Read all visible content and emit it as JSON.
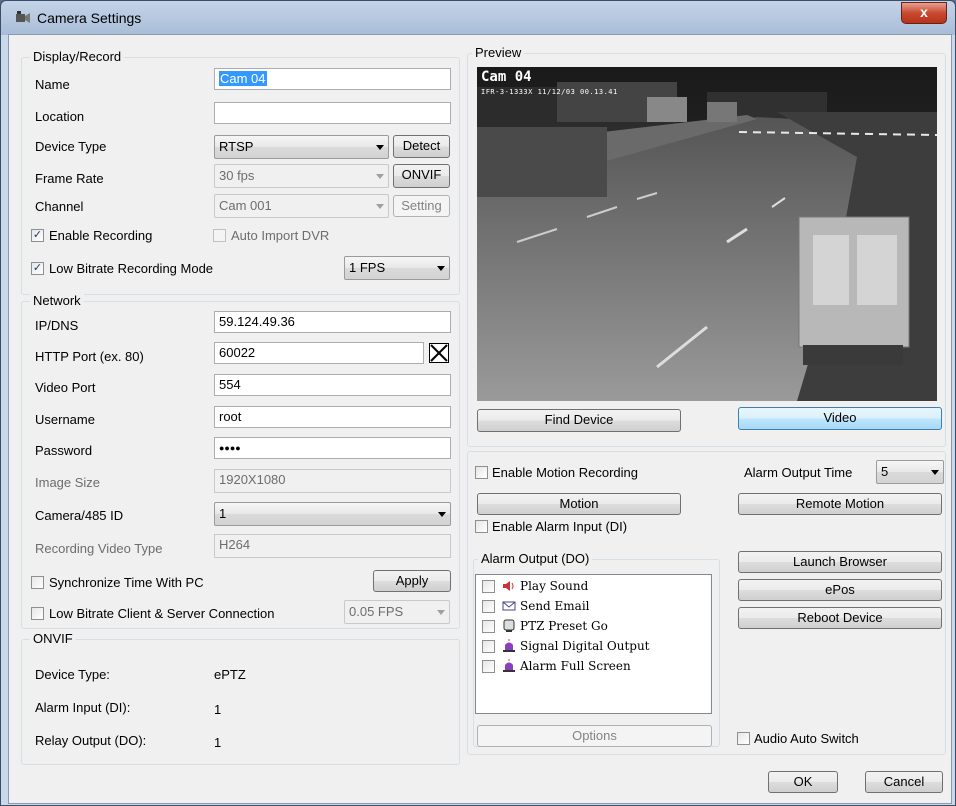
{
  "window": {
    "title": "Camera Settings",
    "close": "x"
  },
  "display_record": {
    "legend": "Display/Record",
    "name_label": "Name",
    "name_value": "Cam 04",
    "location_label": "Location",
    "location_value": "",
    "device_type_label": "Device Type",
    "device_type_value": "RTSP",
    "detect_button": "Detect",
    "frame_rate_label": "Frame Rate",
    "frame_rate_value": "30 fps",
    "onvif_button": "ONVIF",
    "channel_label": "Channel",
    "channel_value": "Cam 001",
    "setting_button": "Setting",
    "enable_recording_label": "Enable Recording",
    "enable_recording_checked": true,
    "auto_import_label": "Auto Import DVR",
    "auto_import_checked": false,
    "low_bitrate_label": "Low Bitrate Recording Mode",
    "low_bitrate_checked": true,
    "low_bitrate_value": "1 FPS"
  },
  "network": {
    "legend": "Network",
    "ip_label": "IP/DNS",
    "ip_value": "59.124.49.36",
    "http_port_label": "HTTP Port (ex. 80)",
    "http_port_value": "60022",
    "video_port_label": "Video Port",
    "video_port_value": "554",
    "username_label": "Username",
    "username_value": "root",
    "password_label": "Password",
    "password_value": "●●●●",
    "image_size_label": "Image Size",
    "image_size_value": "1920X1080",
    "camera_id_label": "Camera/485 ID",
    "camera_id_value": "1",
    "recording_type_label": "Recording Video Type",
    "recording_type_value": "H264",
    "sync_time_label": "Synchronize Time With PC",
    "sync_time_checked": false,
    "apply_button": "Apply",
    "low_bitrate_conn_label": "Low Bitrate Client & Server Connection",
    "low_bitrate_conn_checked": false,
    "low_bitrate_conn_value": "0.05 FPS"
  },
  "onvif": {
    "legend": "ONVIF",
    "device_type_label": "Device Type:",
    "device_type_value": "ePTZ",
    "alarm_input_label": "Alarm Input (DI):",
    "alarm_input_value": "1",
    "relay_output_label": "Relay Output (DO):",
    "relay_output_value": "1"
  },
  "preview": {
    "legend": "Preview",
    "overlay_name": "Cam 04",
    "overlay_info": "IFR-3-1333X  11/12/03  00.13.41",
    "find_device_button": "Find Device",
    "video_button": "Video"
  },
  "alarm": {
    "enable_motion_label": "Enable Motion Recording",
    "enable_motion_checked": false,
    "alarm_output_time_label": "Alarm Output Time",
    "alarm_output_time_value": "5",
    "motion_button": "Motion",
    "remote_motion_button": "Remote Motion",
    "enable_alarm_input_label": "Enable Alarm Input (DI)",
    "enable_alarm_input_checked": false,
    "alarm_output_legend": "Alarm Output (DO)",
    "outputs": [
      {
        "label": "Play Sound",
        "icon": "speaker-icon",
        "checked": false
      },
      {
        "label": "Send Email",
        "icon": "envelope-icon",
        "checked": false
      },
      {
        "label": "PTZ Preset Go",
        "icon": "ptz-camera-icon",
        "checked": false
      },
      {
        "label": "Signal Digital Output",
        "icon": "alarm-siren-icon",
        "checked": false
      },
      {
        "label": "Alarm Full Screen",
        "icon": "alarm-siren-icon",
        "checked": false
      }
    ],
    "options_button": "Options",
    "launch_browser_button": "Launch Browser",
    "epos_button": "ePos",
    "reboot_button": "Reboot Device",
    "audio_auto_switch_label": "Audio Auto Switch",
    "audio_auto_switch_checked": false
  },
  "footer": {
    "ok_button": "OK",
    "cancel_button": "Cancel"
  },
  "colors": {
    "title_bar": "#b4c7e0",
    "selection": "#3399ff",
    "close": "#c84a30",
    "focus_button": "#bee6fd"
  }
}
